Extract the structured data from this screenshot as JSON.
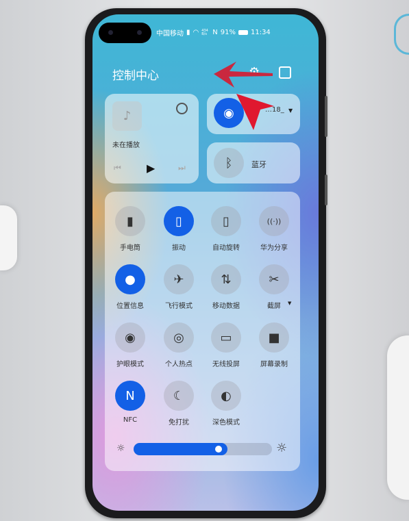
{
  "status_bar": {
    "carrier": "中国移动",
    "net_speed": "434 B/s",
    "battery": "91%",
    "time": "11:34"
  },
  "header": {
    "title": "控制中心",
    "settings_icon": "gear-icon",
    "edit_icon": "edit-icon"
  },
  "media": {
    "status": "未在播放",
    "icons": [
      "music-note-icon",
      "audio-output-icon",
      "previous-icon",
      "play-icon",
      "next-icon"
    ]
  },
  "wifi": {
    "ssid": "…18_",
    "active": true
  },
  "bluetooth": {
    "label": "蓝牙",
    "active": false
  },
  "toggles": [
    {
      "label": "手电筒",
      "icon": "flashlight-icon",
      "active": false
    },
    {
      "label": "振动",
      "icon": "vibrate-icon",
      "active": true
    },
    {
      "label": "自动旋转",
      "icon": "rotate-icon",
      "active": false
    },
    {
      "label": "华为分享",
      "icon": "share-icon",
      "active": false
    },
    {
      "label": "位置信息",
      "icon": "location-icon",
      "active": true
    },
    {
      "label": "飞行模式",
      "icon": "airplane-icon",
      "active": false
    },
    {
      "label": "移动数据",
      "icon": "mobile-data-icon",
      "active": false
    },
    {
      "label": "截屏",
      "icon": "screenshot-icon",
      "active": false
    },
    {
      "label": "护眼模式",
      "icon": "eye-icon",
      "active": false
    },
    {
      "label": "个人热点",
      "icon": "hotspot-icon",
      "active": false
    },
    {
      "label": "无线投屏",
      "icon": "cast-icon",
      "active": false
    },
    {
      "label": "屏幕录制",
      "icon": "record-icon",
      "active": false
    },
    {
      "label": "NFC",
      "icon": "nfc-icon",
      "active": true
    },
    {
      "label": "免打扰",
      "icon": "moon-icon",
      "active": false
    },
    {
      "label": "深色模式",
      "icon": "dark-mode-icon",
      "active": false
    }
  ],
  "brightness": {
    "level": 0.68
  },
  "colors": {
    "accent": "#1360e6",
    "annotation_arrow": "#e0182f"
  }
}
